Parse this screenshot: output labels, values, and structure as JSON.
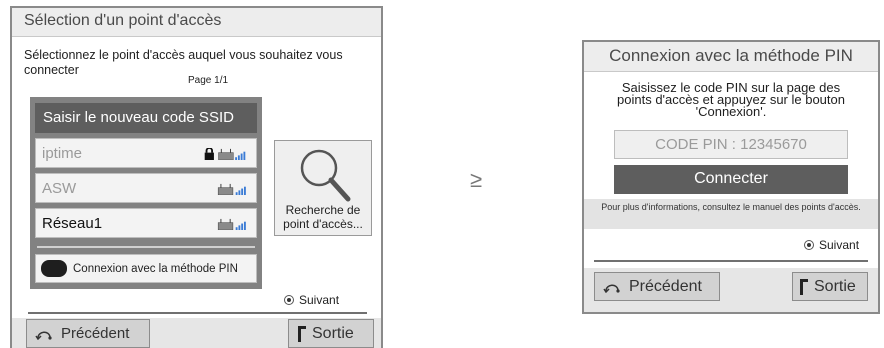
{
  "left": {
    "title": "Sélection d'un point d'accès",
    "instruction": "Sélectionnez le point d'accès auquel vous souhaitez vous connecter",
    "page": "Page 1/1",
    "new_ssid": "Saisir le nouveau code SSID",
    "access_points": [
      {
        "name": "iptime",
        "locked": true
      },
      {
        "name": "ASW",
        "locked": false
      },
      {
        "name": "Réseau1",
        "locked": false
      }
    ],
    "pin_button": "Connexion avec la méthode PIN",
    "search_label": "Recherche de point d'accès...",
    "next": "Suivant",
    "back": "Précédent",
    "exit": "Sortie"
  },
  "separator_glyph": "≥",
  "right": {
    "title": "Connexion avec la méthode PIN",
    "instruction": "Saisissez le code PIN sur la page des points d'accès et appuyez sur le bouton 'Connexion'.",
    "pin_code": "CODE PIN : 12345670",
    "connect": "Connecter",
    "info": "Pour plus d'informations, consultez le manuel des points d'accès.",
    "next": "Suivant",
    "back": "Précédent",
    "exit": "Sortie"
  },
  "colors": {
    "dialog_border": "#8a8a8a",
    "dark_bar": "#5e5e5e",
    "panel_gray": "#828282",
    "footer_gray": "#e6e6e6",
    "signal_blue": "#3a7bd5"
  }
}
